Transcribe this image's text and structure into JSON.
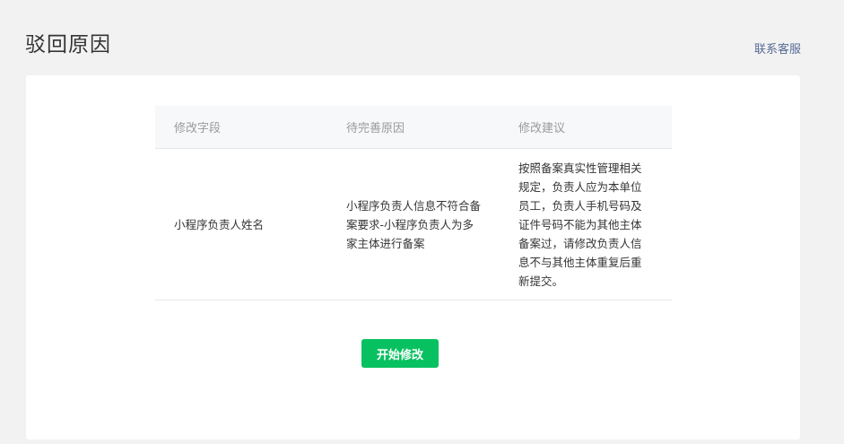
{
  "header": {
    "title": "驳回原因",
    "contact_label": "联系客服"
  },
  "table": {
    "columns": [
      "修改字段",
      "待完善原因",
      "修改建议"
    ],
    "rows": [
      {
        "field": "小程序负责人姓名",
        "reason": "小程序负责人信息不符合备案要求-小程序负责人为多家主体进行备案",
        "advice": "按照备案真实性管理相关规定，负责人应为本单位员工，负责人手机号码及证件号码不能为其他主体备案过，请修改负责人信息不与其他主体重复后重新提交。"
      }
    ]
  },
  "actions": {
    "start_edit_label": "开始修改"
  },
  "colors": {
    "primary": "#07c160",
    "link": "#576b95",
    "background": "#f2f2f2"
  }
}
